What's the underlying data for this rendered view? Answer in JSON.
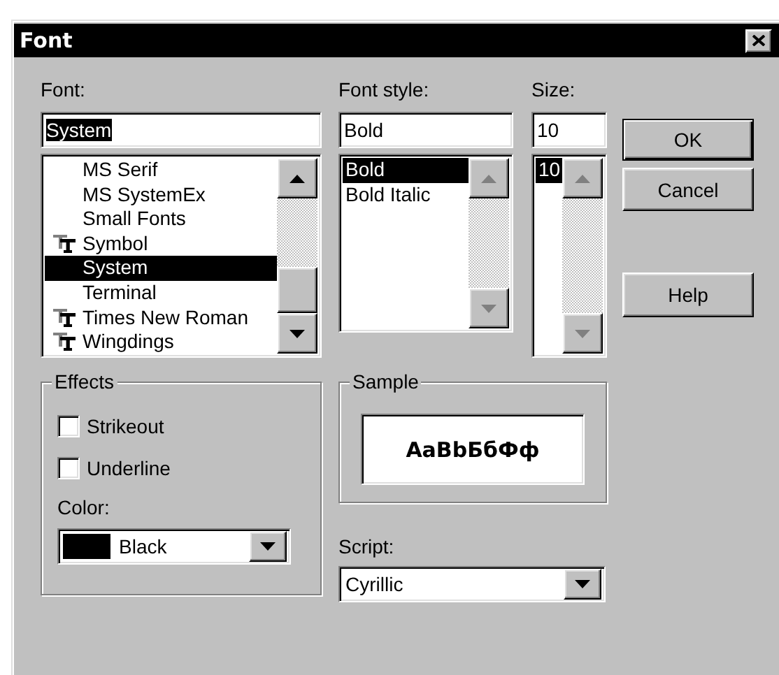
{
  "window": {
    "title": "Font"
  },
  "font": {
    "label": "Font:",
    "value": "System",
    "value_selected": true,
    "items": [
      {
        "name": "MS Serif",
        "truetype": false,
        "selected": false
      },
      {
        "name": "MS SystemEx",
        "truetype": false,
        "selected": false
      },
      {
        "name": "Small Fonts",
        "truetype": false,
        "selected": false
      },
      {
        "name": "Symbol",
        "truetype": true,
        "selected": false
      },
      {
        "name": "System",
        "truetype": false,
        "selected": true
      },
      {
        "name": "Terminal",
        "truetype": false,
        "selected": false
      },
      {
        "name": "Times New Roman",
        "truetype": true,
        "selected": false
      },
      {
        "name": "Wingdings",
        "truetype": true,
        "selected": false
      }
    ]
  },
  "font_style": {
    "label": "Font style:",
    "value": "Bold",
    "value_selected": false,
    "items": [
      {
        "name": "Bold",
        "selected": true
      },
      {
        "name": "Bold Italic",
        "selected": false
      }
    ]
  },
  "size": {
    "label": "Size:",
    "value": "10",
    "value_selected": false,
    "items": [
      {
        "name": "10",
        "selected": true
      }
    ]
  },
  "buttons": [
    {
      "label": "OK",
      "default": true
    },
    {
      "label": "Cancel",
      "default": false
    },
    {
      "label": "Help",
      "default": false
    }
  ],
  "effects": {
    "title": "Effects",
    "checkboxes": [
      {
        "label": "Strikeout",
        "checked": false
      },
      {
        "label": "Underline",
        "checked": false
      }
    ],
    "color": {
      "label": "Color:",
      "value": "Black",
      "swatch": {
        "color": "#000000"
      }
    }
  },
  "sample": {
    "title": "Sample",
    "text": "AaBbБбФф"
  },
  "script": {
    "label": "Script:",
    "value": "Cyrillic"
  }
}
